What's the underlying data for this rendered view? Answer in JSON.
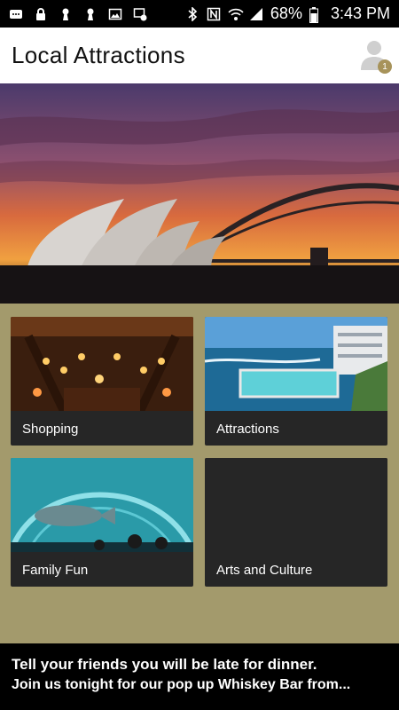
{
  "status_bar": {
    "battery": "68%",
    "time": "3:43 PM"
  },
  "header": {
    "title": "Local Attractions",
    "notification_count": "1"
  },
  "tiles": [
    {
      "label": "Shopping"
    },
    {
      "label": "Attractions"
    },
    {
      "label": "Family Fun"
    },
    {
      "label": "Arts and Culture"
    }
  ],
  "banner": {
    "line1": "Tell your friends you will be late for dinner.",
    "line2": "Join us tonight for our pop up Whiskey Bar from..."
  },
  "colors": {
    "accent": "#a39a6c",
    "badge": "#a7935a",
    "tile_bg": "#262626"
  }
}
